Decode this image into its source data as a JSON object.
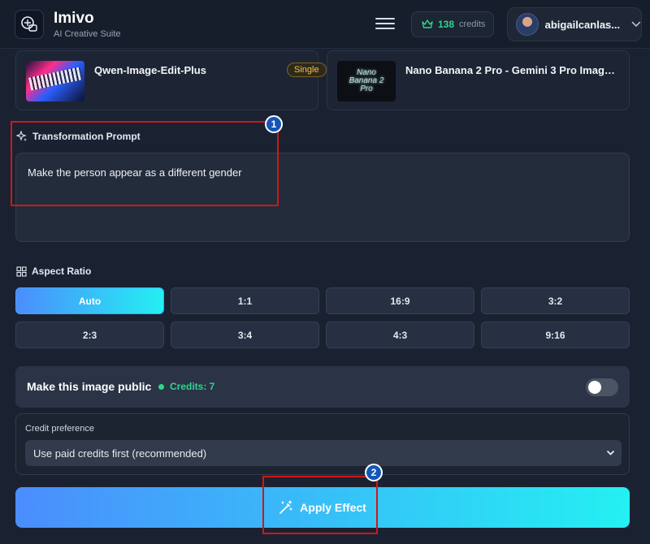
{
  "header": {
    "app_title": "Imivo",
    "app_subtitle": "AI Creative Suite",
    "credits_count": "138",
    "credits_label": "credits",
    "username": "abigailcanlas..."
  },
  "models": [
    {
      "name": "Qwen-Image-Edit-Plus",
      "badge": "Single",
      "thumb_icon": "neon-collage-thumbnail"
    },
    {
      "name": "Nano Banana 2 Pro - Gemini 3 Pro Image P...",
      "thumb_text": [
        "Nano",
        "Banana 2",
        "Pro"
      ]
    }
  ],
  "prompt": {
    "label": "Transformation Prompt",
    "value": "Make the person appear as a different gender"
  },
  "aspect_ratio": {
    "label": "Aspect Ratio",
    "options": [
      "Auto",
      "1:1",
      "16:9",
      "3:2",
      "2:3",
      "3:4",
      "4:3",
      "9:16"
    ],
    "selected": "Auto"
  },
  "public": {
    "label": "Make this image public",
    "credits_text": "Credits: 7",
    "enabled": false
  },
  "credit_preference": {
    "label": "Credit preference",
    "selected": "Use paid credits first (recommended)"
  },
  "apply": {
    "label": "Apply Effect"
  },
  "annotations": {
    "one": "1",
    "two": "2"
  },
  "colors": {
    "accent_start": "#4b8dfd",
    "accent_end": "#24f0f2",
    "credits_green": "#2fd68a",
    "annotation_red": "#d11717",
    "badge_gold": "#f5c04a"
  }
}
